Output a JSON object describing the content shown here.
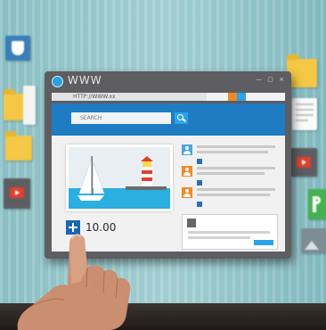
{
  "window": {
    "title": "WWW",
    "controls": "— ▢ ×"
  },
  "address_bar": {
    "url": "HTTP://WWW.xx"
  },
  "search": {
    "placeholder": "SEARCH"
  },
  "post": {
    "share_count": "10.00"
  },
  "colors": {
    "wall": "#a8d4d7",
    "device_frame": "#5e5d61",
    "header_blue": "#1f7cc3",
    "search_button": "#2ba3e6",
    "feed_avatar_blue": "#4aa7de",
    "feed_avatar_orange": "#ef8a2a",
    "folder_yellow": "#f4c844",
    "video_red": "#e0402e",
    "accent_green": "#47b052"
  },
  "icons": {
    "top_left_tile": "shield-icon",
    "share": "plus-icon",
    "feed_avatar": "user-icon",
    "search": "search-icon"
  }
}
